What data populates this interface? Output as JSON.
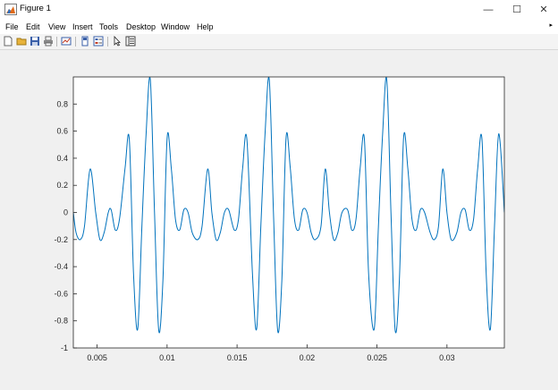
{
  "window": {
    "title": "Figure 1",
    "minimize_glyph": "—",
    "maximize_glyph": "☐",
    "close_glyph": "✕"
  },
  "menubar": {
    "items": [
      "File",
      "Edit",
      "View",
      "Insert",
      "Tools",
      "Desktop",
      "Window",
      "Help"
    ],
    "overflow_glyph": "▸"
  },
  "toolbar": {
    "icons": [
      "new-figure-icon",
      "open-file-icon",
      "save-icon",
      "print-icon",
      "link-plot-icon",
      "colorbar-icon",
      "legend-icon",
      "pointer-icon",
      "property-inspector-icon"
    ]
  },
  "colors": {
    "line": "#0072bd",
    "axes_bg": "#ffffff",
    "figure_bg": "#f0f0f0",
    "axis_color": "#262626"
  },
  "chart_data": {
    "type": "line",
    "title": "",
    "xlabel": "",
    "ylabel": "",
    "xlim": [
      0.0033,
      0.0341
    ],
    "ylim": [
      -1,
      1
    ],
    "xticks": [
      0.005,
      0.01,
      0.015,
      0.02,
      0.025,
      0.03
    ],
    "xtick_labels": [
      "0.005",
      "0.01",
      "0.015",
      "0.02",
      "0.025",
      "0.03"
    ],
    "yticks": [
      -1,
      -0.8,
      -0.6,
      -0.4,
      -0.2,
      0,
      0.2,
      0.4,
      0.6,
      0.8
    ],
    "ytick_labels": [
      "-1",
      "-0.8",
      "-0.6",
      "-0.4",
      "-0.2",
      "0",
      "0.2",
      "0.4",
      "0.6",
      "0.8"
    ],
    "grid": false,
    "series": [
      {
        "x": [
          0.0033,
          0.0035,
          0.0038,
          0.0041,
          0.0045,
          0.0049,
          0.0052,
          0.0055,
          0.0058,
          0.006,
          0.0063,
          0.0066,
          0.007,
          0.0073,
          0.0076,
          0.0079,
          0.0082,
          0.0085,
          0.0088,
          0.0091,
          0.0094,
          0.0097,
          0.01,
          0.0103,
          0.0106,
          0.0109,
          0.0112,
          0.0115,
          0.0118,
          0.0122,
          0.0125,
          0.0129,
          0.0132,
          0.0135,
          0.0138,
          0.0141,
          0.0144,
          0.0148,
          0.0151,
          0.0154,
          0.0157,
          0.0161,
          0.0164,
          0.0167,
          0.017,
          0.0173,
          0.0176,
          0.0179,
          0.0182,
          0.0185,
          0.0188,
          0.0191,
          0.0194,
          0.0197,
          0.02,
          0.0203,
          0.0206,
          0.021,
          0.0213,
          0.0216,
          0.0219,
          0.0222,
          0.0225,
          0.0229,
          0.0232,
          0.0235,
          0.0238,
          0.0241,
          0.0244,
          0.0248,
          0.0251,
          0.0254,
          0.0257,
          0.026,
          0.0263,
          0.0266,
          0.0269,
          0.0272,
          0.0275,
          0.0278,
          0.0281,
          0.0284,
          0.0288,
          0.0291,
          0.0294,
          0.0297,
          0.03,
          0.0303,
          0.0307,
          0.031,
          0.0313,
          0.0316,
          0.0319,
          0.0322,
          0.0325,
          0.0328,
          0.0331,
          0.0334,
          0.0337,
          0.0341
        ],
        "y": [
          0.0,
          -0.15,
          -0.2,
          -0.1,
          0.32,
          0.0,
          -0.2,
          -0.15,
          0.0,
          0.02,
          -0.13,
          -0.05,
          0.33,
          0.54,
          -0.45,
          -0.86,
          -0.1,
          0.58,
          0.98,
          0.0,
          -0.87,
          -0.5,
          0.55,
          0.33,
          -0.05,
          -0.13,
          0.02,
          0.0,
          -0.15,
          -0.2,
          -0.1,
          0.32,
          0.0,
          -0.2,
          -0.15,
          0.0,
          0.02,
          -0.13,
          -0.05,
          0.33,
          0.54,
          -0.45,
          -0.86,
          -0.1,
          0.58,
          0.98,
          0.0,
          -0.87,
          -0.5,
          0.55,
          0.33,
          -0.05,
          -0.13,
          0.02,
          0.0,
          -0.15,
          -0.2,
          -0.1,
          0.32,
          0.0,
          -0.2,
          -0.15,
          0.0,
          0.02,
          -0.13,
          -0.05,
          0.33,
          0.54,
          -0.45,
          -0.86,
          -0.1,
          0.58,
          0.98,
          0.0,
          -0.87,
          -0.5,
          0.55,
          0.33,
          -0.05,
          -0.13,
          0.02,
          0.0,
          -0.15,
          -0.2,
          -0.1,
          0.32,
          0.0,
          -0.2,
          -0.15,
          0.0,
          0.02,
          -0.13,
          -0.05,
          0.33,
          0.54,
          -0.45,
          -0.86,
          -0.1,
          0.58,
          0.0
        ]
      }
    ]
  }
}
